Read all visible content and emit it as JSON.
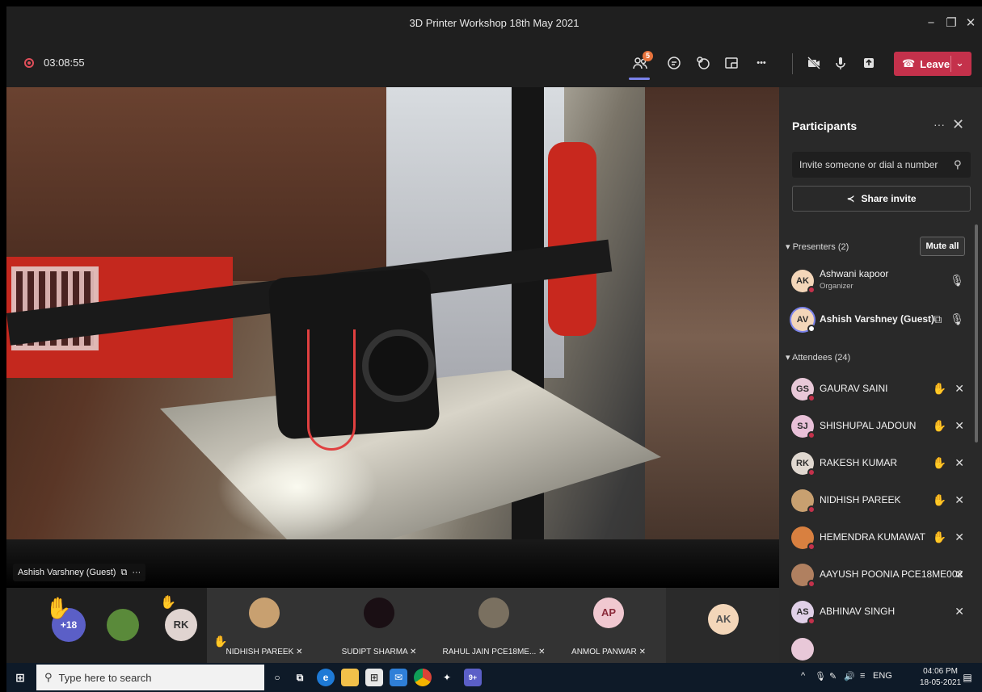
{
  "window": {
    "title": "3D Printer Workshop 18th May 2021",
    "minimize": "−",
    "maximize": "❐",
    "close": "✕"
  },
  "toolbar": {
    "timer": "03:08:55",
    "participant_badge": "5",
    "more": "•••",
    "leave_label": "Leave",
    "leave_color": "#c4314b"
  },
  "video": {
    "name_tag": "Ashish Varshney (Guest)",
    "name_more": "···"
  },
  "panel": {
    "title": "Participants",
    "more": "···",
    "close": "✕",
    "invite_placeholder": "Invite someone or dial a number",
    "share_label": "Share invite",
    "presenters_label": "Presenters (2)",
    "mute_all": "Mute all",
    "attendees_label": "Attendees (24)",
    "presenters": [
      {
        "initials": "AK",
        "name": "Ashwani kapoor",
        "role": "Organizer",
        "color": "#f3d6b9"
      },
      {
        "initials": "AV",
        "name": "Ashish Varshney (Guest)",
        "role": "",
        "color": "#f3d6b9"
      }
    ],
    "attendees": [
      {
        "initials": "GS",
        "name": "GAURAV SAINI",
        "color": "#e8c8d8"
      },
      {
        "initials": "SJ",
        "name": "SHISHUPAL JADOUN",
        "color": "#e8c0d8"
      },
      {
        "initials": "RK",
        "name": "RAKESH KUMAR",
        "color": "#e0d8d0"
      },
      {
        "initials": "",
        "name": "NIDHISH PAREEK",
        "color": "#c8a070"
      },
      {
        "initials": "",
        "name": "HEMENDRA KUMAWAT",
        "color": "#d88040"
      },
      {
        "initials": "",
        "name": "AAYUSH POONIA PCE18ME002",
        "color": "#b08060"
      },
      {
        "initials": "AS",
        "name": "ABHINAV SINGH",
        "color": "#e0d0e8"
      }
    ]
  },
  "gallery": {
    "overflow_count": "+18",
    "rk_initials": "RK",
    "ap_initials": "AP",
    "ak_initials": "AK",
    "tiles": [
      {
        "name": "NIDHISH PAREEK"
      },
      {
        "name": "SUDIPT SHARMA"
      },
      {
        "name": "RAHUL JAIN PCE18ME..."
      },
      {
        "name": "ANMOL PANWAR"
      }
    ]
  },
  "taskbar": {
    "search_placeholder": "Type here to search",
    "lang": "ENG",
    "time": "04:06 PM",
    "date": "18-05-2021",
    "teams_badge": "9+"
  }
}
